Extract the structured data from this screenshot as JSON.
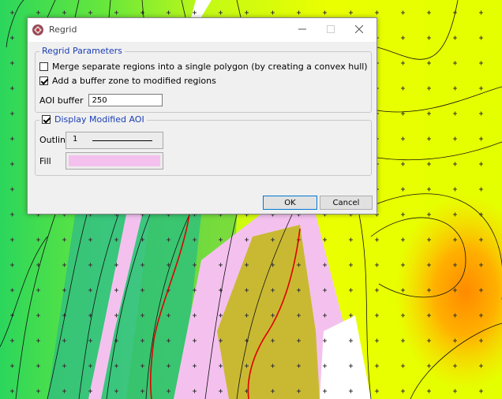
{
  "dialog": {
    "title": "Regrid",
    "window_controls": {
      "minimize": "minimize-icon",
      "maximize": "maximize-icon",
      "close": "close-icon"
    },
    "regrid_parameters": {
      "group_label": "Regrid Parameters",
      "merge_regions": {
        "label": "Merge separate regions into a single polygon (by creating a convex hull)",
        "checked": false
      },
      "buffer_zone": {
        "label": "Add a buffer zone to modified regions",
        "checked": true
      },
      "aoi_buffer": {
        "label": "AOI buffer",
        "value": "250"
      }
    },
    "display_modified_aoi": {
      "group_label": "Display Modified AOI",
      "checked": true,
      "outline": {
        "label": "Outline",
        "value": "1"
      },
      "fill": {
        "label": "Fill",
        "color": "#f4c1ef"
      }
    },
    "buttons": {
      "ok": "OK",
      "cancel": "Cancel"
    }
  },
  "map": {
    "colors": {
      "green": "#2bd65c",
      "yellow": "#e4ff00",
      "orange": "#ff8a00",
      "modified_aoi": "#f4c1ef",
      "red_contour": "#e00000"
    }
  }
}
